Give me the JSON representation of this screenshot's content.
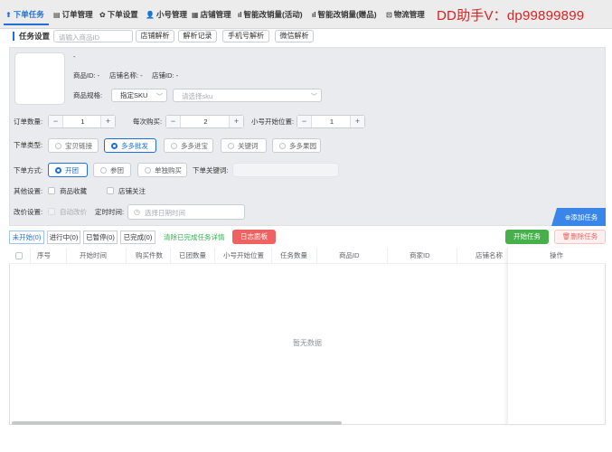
{
  "nav": {
    "items": [
      {
        "icon": "⬆",
        "label": "下单任务"
      },
      {
        "icon": "▤",
        "label": "订单管理"
      },
      {
        "icon": "✿",
        "label": "下单设置"
      },
      {
        "icon": "👤",
        "label": "小号管理"
      },
      {
        "icon": "▦",
        "label": "店铺管理"
      },
      {
        "icon": "ıl",
        "label": "智能改销量(活动)"
      },
      {
        "icon": "ıl",
        "label": "智能改销量(赠品)"
      },
      {
        "icon": "⊡",
        "label": "物流管理"
      }
    ],
    "promo": "DD助手V：dp99899899"
  },
  "task_settings": {
    "title": "任务设置",
    "product_id_placeholder": "请输入商品ID",
    "buttons": [
      "店铺解析",
      "解析记录",
      "手机号解析",
      "微信解析"
    ]
  },
  "product": {
    "name": "-",
    "product_id_label": "商品ID: -",
    "shop_name_label": "店铺名称: -",
    "shop_id_label": "店铺ID: -",
    "spec_label": "商品规格:",
    "spec_value": "指定SKU",
    "sku_placeholder": "请选择sku"
  },
  "quantities": {
    "order_qty_label": "订单数量:",
    "order_qty": "1",
    "per_buy_label": "每次购买:",
    "per_buy": "2",
    "start_pos_label": "小号开始位置:",
    "start_pos": "1"
  },
  "order_type": {
    "label": "下单类型:",
    "options": [
      "宝贝链接",
      "多多批发",
      "多多进宝",
      "关键词",
      "多多果园"
    ],
    "selected": "多多批发"
  },
  "order_mode": {
    "label": "下单方式:",
    "options": [
      "开团",
      "参团",
      "单独购买"
    ],
    "selected": "开团",
    "keyword_label": "下单关键词:"
  },
  "other": {
    "label": "其他设置:",
    "options": [
      "商品收藏",
      "店铺关注"
    ]
  },
  "price_change": {
    "label": "改价设置:",
    "auto_label": "自动改价",
    "timer_label": "定时时间:",
    "date_placeholder": "选择日期时间"
  },
  "add_task": "添加任务",
  "tabs": [
    "未开始(0)",
    "进行中(0)",
    "已暂停(0)",
    "已完成(0)"
  ],
  "clear_link": "清除已完成任务详情",
  "log_button": "日志面板",
  "start_button": "开始任务",
  "delete_button": "删除任务",
  "table": {
    "columns": [
      "序号",
      "开始时间",
      "购买件数",
      "已团数量",
      "小号开始位置",
      "任务数量",
      "商品ID",
      "商家ID",
      "店铺名称",
      "操作"
    ],
    "empty_text": "暂无数据"
  },
  "colors": {
    "accent": "#1f6fd6",
    "promo": "#e02020",
    "success": "#48b04a",
    "danger": "#f06161"
  }
}
